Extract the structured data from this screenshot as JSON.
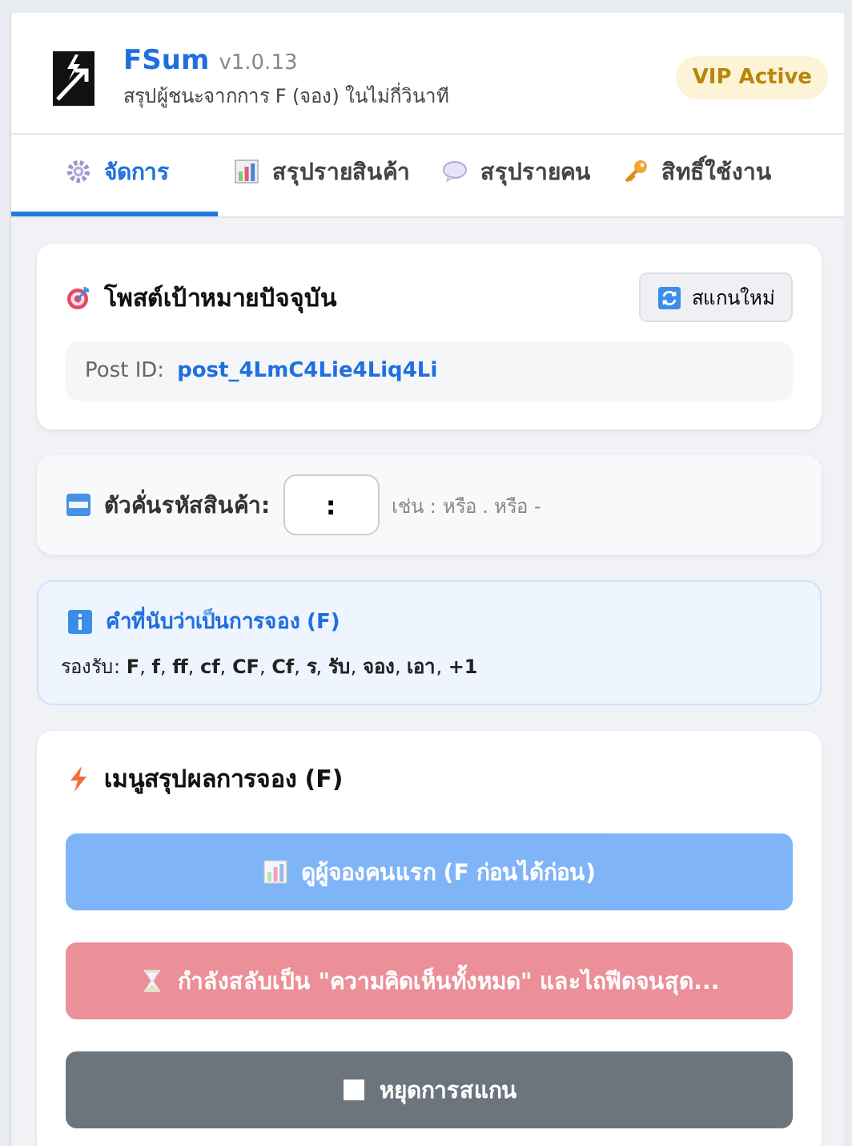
{
  "header": {
    "title": "FSum",
    "version": "v1.0.13",
    "subtitle": "สรุปผู้ชนะจากการ F (จอง) ในไม่กี่วินาที",
    "badge": "VIP Active"
  },
  "tabs": [
    {
      "label": "จัดการ",
      "selected": true
    },
    {
      "label": "สรุปรายสินค้า",
      "selected": false
    },
    {
      "label": "สรุปรายคน",
      "selected": false
    },
    {
      "label": "สิทธิ์ใช้งาน",
      "selected": false
    }
  ],
  "target_post": {
    "title": "โพสต์เป้าหมายปัจจุบัน",
    "rescan_button": "สแกนใหม่",
    "post_id_label": "Post ID:",
    "post_id": "post_4LmC4Lie4Liq4Li"
  },
  "separator": {
    "label": "ตัวคั่นรหัสสินค้า:",
    "value": ":",
    "hint": "เช่น : หรือ . หรือ -"
  },
  "info": {
    "title": "คำที่นับว่าเป็นการจอง (F)",
    "text": "รองรับ: **F**, **f**, **ff**, **cf**, **CF**, **Cf**, **ร**, **รับ**, **จอง**, **เอา**, **+1**"
  },
  "summary_menu": {
    "title": "เมนูสรุปผลการจอง (F)",
    "buttons": [
      {
        "label": "ดูผู้จองคนแรก (F ก่อนได้ก่อน)",
        "kind": "primary",
        "disabled": true
      },
      {
        "label": "กำลังสลับเป็น \"ความคิดเห็นทั้งหมด\" และไถฟีดจนสุด...",
        "kind": "danger",
        "disabled": true
      },
      {
        "label": "หยุดการสแกน",
        "kind": "secondary",
        "disabled": false
      }
    ]
  }
}
